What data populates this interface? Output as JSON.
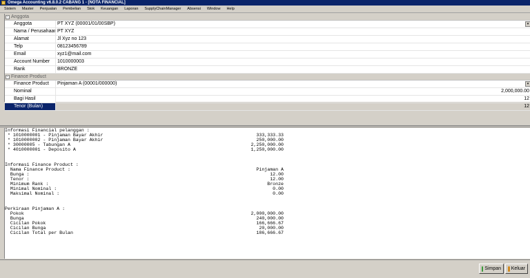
{
  "window": {
    "title": "Omega Accounting v6.8.0.2 CABANG 1 - [NOTA FINANCIAL]"
  },
  "menu": [
    "Sistem",
    "Master",
    "Penjualan",
    "Pembelian",
    "Stok",
    "Keuangan",
    "Laporan",
    "SupplyChainManager",
    "Absensi",
    "Window",
    "Help"
  ],
  "anggota": {
    "label": "Anggota",
    "rows": [
      {
        "label": "Anggota",
        "value": "PT XYZ (00001/01/00SBP)"
      },
      {
        "label": "Nama / Perusahaan",
        "value": "PT XYZ"
      },
      {
        "label": "Alamat",
        "value": "Jl Xyz no 123"
      },
      {
        "label": "Telp",
        "value": "08123456789"
      },
      {
        "label": "Email",
        "value": "xyz1@mail.com"
      },
      {
        "label": "Account Number",
        "value": "1010000003"
      },
      {
        "label": "Rank",
        "value": "BRONZE"
      }
    ]
  },
  "finance": {
    "label": "Finance Product",
    "rows": [
      {
        "label": "Finance Product",
        "value": "Pinjaman A (00001/000000)"
      },
      {
        "label": "Nominal",
        "value": "2,000,000.00"
      },
      {
        "label": "Bagi Hasil",
        "value": "12"
      },
      {
        "label": "Tenor (Bulan)",
        "value": "12"
      }
    ]
  },
  "report": [
    {
      "t": "Informasi Financial pelanggan :",
      "n": ""
    },
    {
      "t": " * 1010000001 - Pinjaman Bayar Akhir",
      "n": "333,333.33"
    },
    {
      "t": " * 1010000002 - Pinjaman Bayar Akhir",
      "n": "250,000.00"
    },
    {
      "t": " * 30000005 - Tabungan A",
      "n": "2,250,000.00"
    },
    {
      "t": " * 4010000001 - Deposito A",
      "n": "1,250,000.00"
    },
    {
      "t": "",
      "n": ""
    },
    {
      "t": "",
      "n": ""
    },
    {
      "t": "Informasi Finance Product :",
      "n": ""
    },
    {
      "t": "  Nama Finance Product :",
      "n": "Pinjaman A"
    },
    {
      "t": "  Bunga :",
      "n": "12.00"
    },
    {
      "t": "  Tenor :",
      "n": "12.00"
    },
    {
      "t": "  Minimum Rank :",
      "n": "Bronze"
    },
    {
      "t": "  Minimal Nominal :",
      "n": "0.00"
    },
    {
      "t": "  Maksimal Nominal :",
      "n": "0.00"
    },
    {
      "t": "",
      "n": ""
    },
    {
      "t": "",
      "n": ""
    },
    {
      "t": "Perkiraan Pinjaman A :",
      "n": ""
    },
    {
      "t": "  Pokok",
      "n": "2,000,000.00"
    },
    {
      "t": "  Bunga",
      "n": "240,000.00"
    },
    {
      "t": "  Cicilan Pokok",
      "n": "166,666.67"
    },
    {
      "t": "  Cicilan Bunga",
      "n": "20,000.00"
    },
    {
      "t": "  Cicilan Total per Bulan",
      "n": "186,666.67"
    }
  ],
  "buttons": {
    "save": "Simpan",
    "exit": "Keluar"
  },
  "colors": {
    "selection": "#0a246a",
    "titlebar": "#0a246a"
  }
}
